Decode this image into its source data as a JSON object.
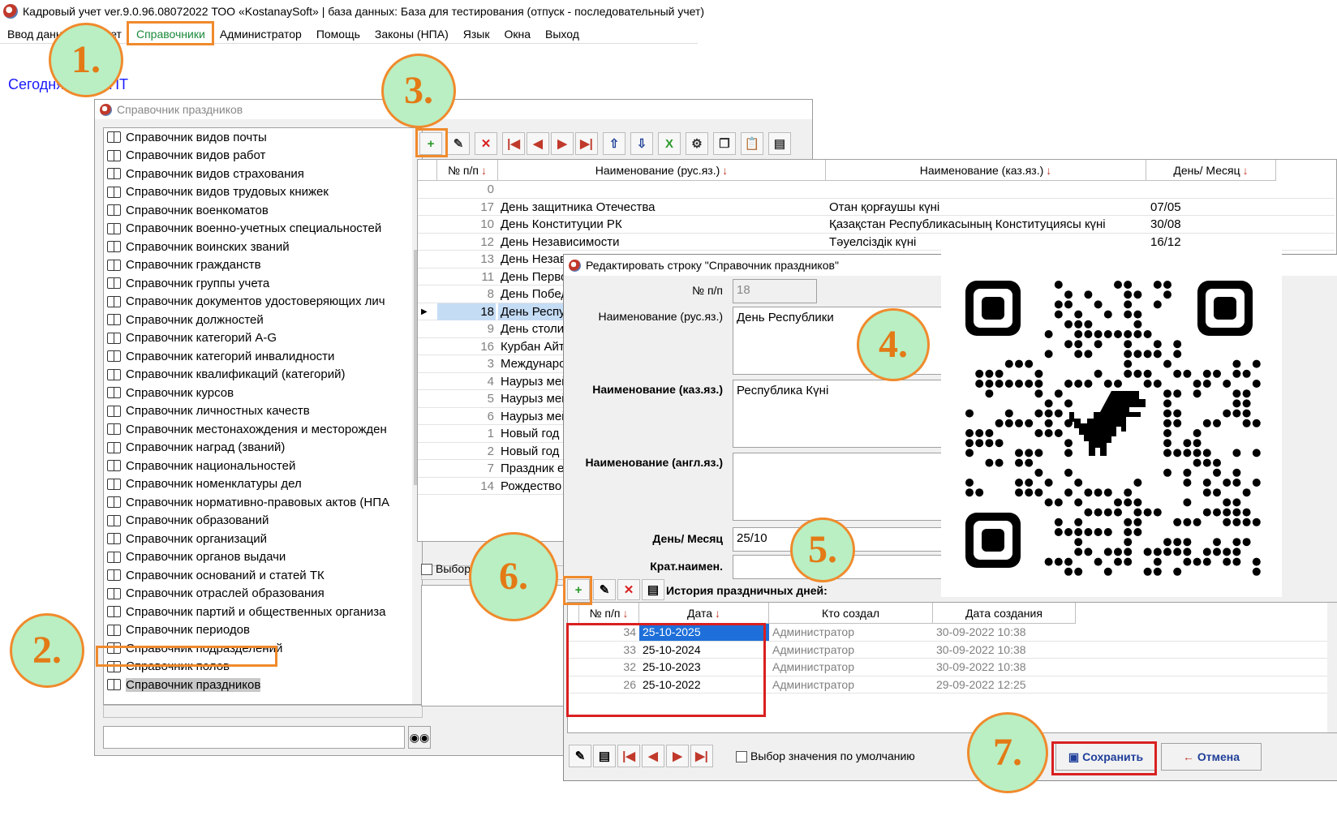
{
  "titlebar": {
    "text": "Кадровый учет ver.9.0.96.08072022 ТОО «KostanaySoft» | база данных: База для тестирования (отпуск - последовательный учет)"
  },
  "menu": [
    "Ввод данных",
    "Отчет",
    "Справочники",
    "Администратор",
    "Помощь",
    "Законы (НПА)",
    "Язык",
    "Окна",
    "Выход"
  ],
  "today": "Сегодня: 2022 ПТ",
  "badges": [
    "1.",
    "2.",
    "3.",
    "4.",
    "5.",
    "6.",
    "7."
  ],
  "main_window": {
    "title": "Справочник праздников"
  },
  "references": [
    "Справочник видов почты",
    "Справочник видов работ",
    "Справочник видов страхования",
    "Справочник видов трудовых книжек",
    "Справочник военкоматов",
    "Справочник военно-учетных специальностей",
    "Справочник воинских званий",
    "Справочник гражданств",
    "Справочник группы учета",
    "Справочник документов удостоверяющих лич",
    "Справочник должностей",
    "Справочник категорий A-G",
    "Справочник категорий инвалидности",
    "Справочник квалификаций (категорий)",
    "Справочник курсов",
    "Справочник личностных качеств",
    "Справочник местонахождения и месторожден",
    "Справочник наград (званий)",
    "Справочник национальностей",
    "Справочник номенклатуры дел",
    "Справочник нормативно-правовых актов (НПА",
    "Справочник образований",
    "Справочник организаций",
    "Справочник органов выдачи",
    "Справочник оснований и статей ТК",
    "Справочник отраслей образования",
    "Справочник партий и общественных организа",
    "Справочник периодов",
    "Справочник подразделений",
    "Справочник полов",
    "Справочник праздников"
  ],
  "grid": {
    "headers": [
      "№ п/п",
      "Наименование (рус.яз.)",
      "Наименование (каз.яз.)",
      "День/ Месяц"
    ],
    "rows": [
      {
        "n": "0",
        "ru": "",
        "kz": "",
        "dm": ""
      },
      {
        "n": "17",
        "ru": "День защитника Отечества",
        "kz": "Отан қорғаушы күні",
        "dm": "07/05"
      },
      {
        "n": "10",
        "ru": "День Конституции РК",
        "kz": "Қазақстан Республикасының Конституциясы күні",
        "dm": "30/08"
      },
      {
        "n": "12",
        "ru": "День Независимости",
        "kz": "Тәуелсіздік күні",
        "dm": "16/12"
      },
      {
        "n": "13",
        "ru": "День Независ",
        "kz": "",
        "dm": ""
      },
      {
        "n": "11",
        "ru": "День Первого",
        "kz": "",
        "dm": ""
      },
      {
        "n": "8",
        "ru": "День Побед",
        "kz": "",
        "dm": ""
      },
      {
        "n": "18",
        "ru": "День Респуб",
        "kz": "",
        "dm": ""
      },
      {
        "n": "9",
        "ru": "День столиц",
        "kz": "",
        "dm": ""
      },
      {
        "n": "16",
        "ru": "Курбан Айт",
        "kz": "",
        "dm": ""
      },
      {
        "n": "3",
        "ru": "Международ",
        "kz": "",
        "dm": ""
      },
      {
        "n": "4",
        "ru": "Наурыз мейр",
        "kz": "",
        "dm": ""
      },
      {
        "n": "5",
        "ru": "Наурыз мейр",
        "kz": "",
        "dm": ""
      },
      {
        "n": "6",
        "ru": "Наурыз мейр",
        "kz": "",
        "dm": ""
      },
      {
        "n": "1",
        "ru": "Новый год",
        "kz": "",
        "dm": ""
      },
      {
        "n": "2",
        "ru": "Новый год",
        "kz": "",
        "dm": ""
      },
      {
        "n": "7",
        "ru": "Праздник еди",
        "kz": "",
        "dm": ""
      },
      {
        "n": "14",
        "ru": "Рождество",
        "kz": "",
        "dm": ""
      }
    ]
  },
  "choice_label": "Выбор",
  "dialog": {
    "title": "Редактировать строку \"Справочник праздников\"",
    "labels": {
      "num": "№ п/п",
      "ru": "Наименование (рус.яз.)",
      "kz": "Наименование (каз.яз.)",
      "en": "Наименование (англ.яз.)",
      "daymonth": "День/ Месяц",
      "short": "Крат.наимен."
    },
    "values": {
      "num": "18",
      "ru": "День Республики",
      "kz": "Республика Күні",
      "en": "",
      "daymonth": "25/10",
      "short": ""
    },
    "history_label": "История праздничных дней:",
    "history_headers": [
      "№ п/п",
      "Дата",
      "Кто создал",
      "Дата создания"
    ],
    "history_rows": [
      {
        "n": "34",
        "date": "25-10-2025",
        "who": "Администратор",
        "created": "30-09-2022 10:38"
      },
      {
        "n": "33",
        "date": "25-10-2024",
        "who": "Администратор",
        "created": "30-09-2022 10:38"
      },
      {
        "n": "32",
        "date": "25-10-2023",
        "who": "Администратор",
        "created": "30-09-2022 10:38"
      },
      {
        "n": "26",
        "date": "25-10-2022",
        "who": "Администратор",
        "created": "29-09-2022 12:25"
      }
    ],
    "default_label": "Выбор значения по умолчанию",
    "save_label": "Сохранить",
    "cancel_label": "Отмена"
  },
  "colors": {
    "badge_fill": "#b9efc2",
    "badge_border": "#f08a2c",
    "highlight_orange": "#f08a2c",
    "highlight_red": "#d92020",
    "selection": "#c5dcf5"
  }
}
